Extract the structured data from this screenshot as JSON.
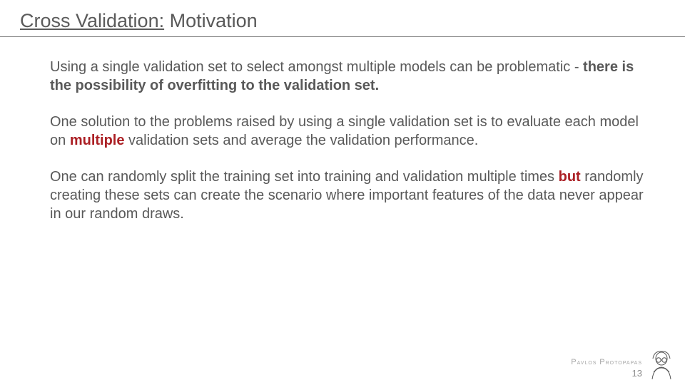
{
  "title": {
    "cv": "Cross Validation:",
    "rest": " Motivation"
  },
  "para1": {
    "lead": "Using a single validation set to select amongst multiple models can be problematic - ",
    "bold": "there is the possibility of overfitting to the validation set."
  },
  "para2": {
    "a": "One solution to the problems raised by using a single validation set is to evaluate each model on ",
    "b": "multiple",
    "c": " validation sets and average the validation performance."
  },
  "para3": {
    "a": "One can randomly split the training set into training and validation multiple times ",
    "b": "but",
    "c": " randomly creating these sets can create the scenario where important features of the data never appear in our random draws."
  },
  "footer": {
    "author_first": "P",
    "author_first_rest": "avlos ",
    "author_last": "P",
    "author_last_rest": "rotopapas",
    "page": "13"
  }
}
